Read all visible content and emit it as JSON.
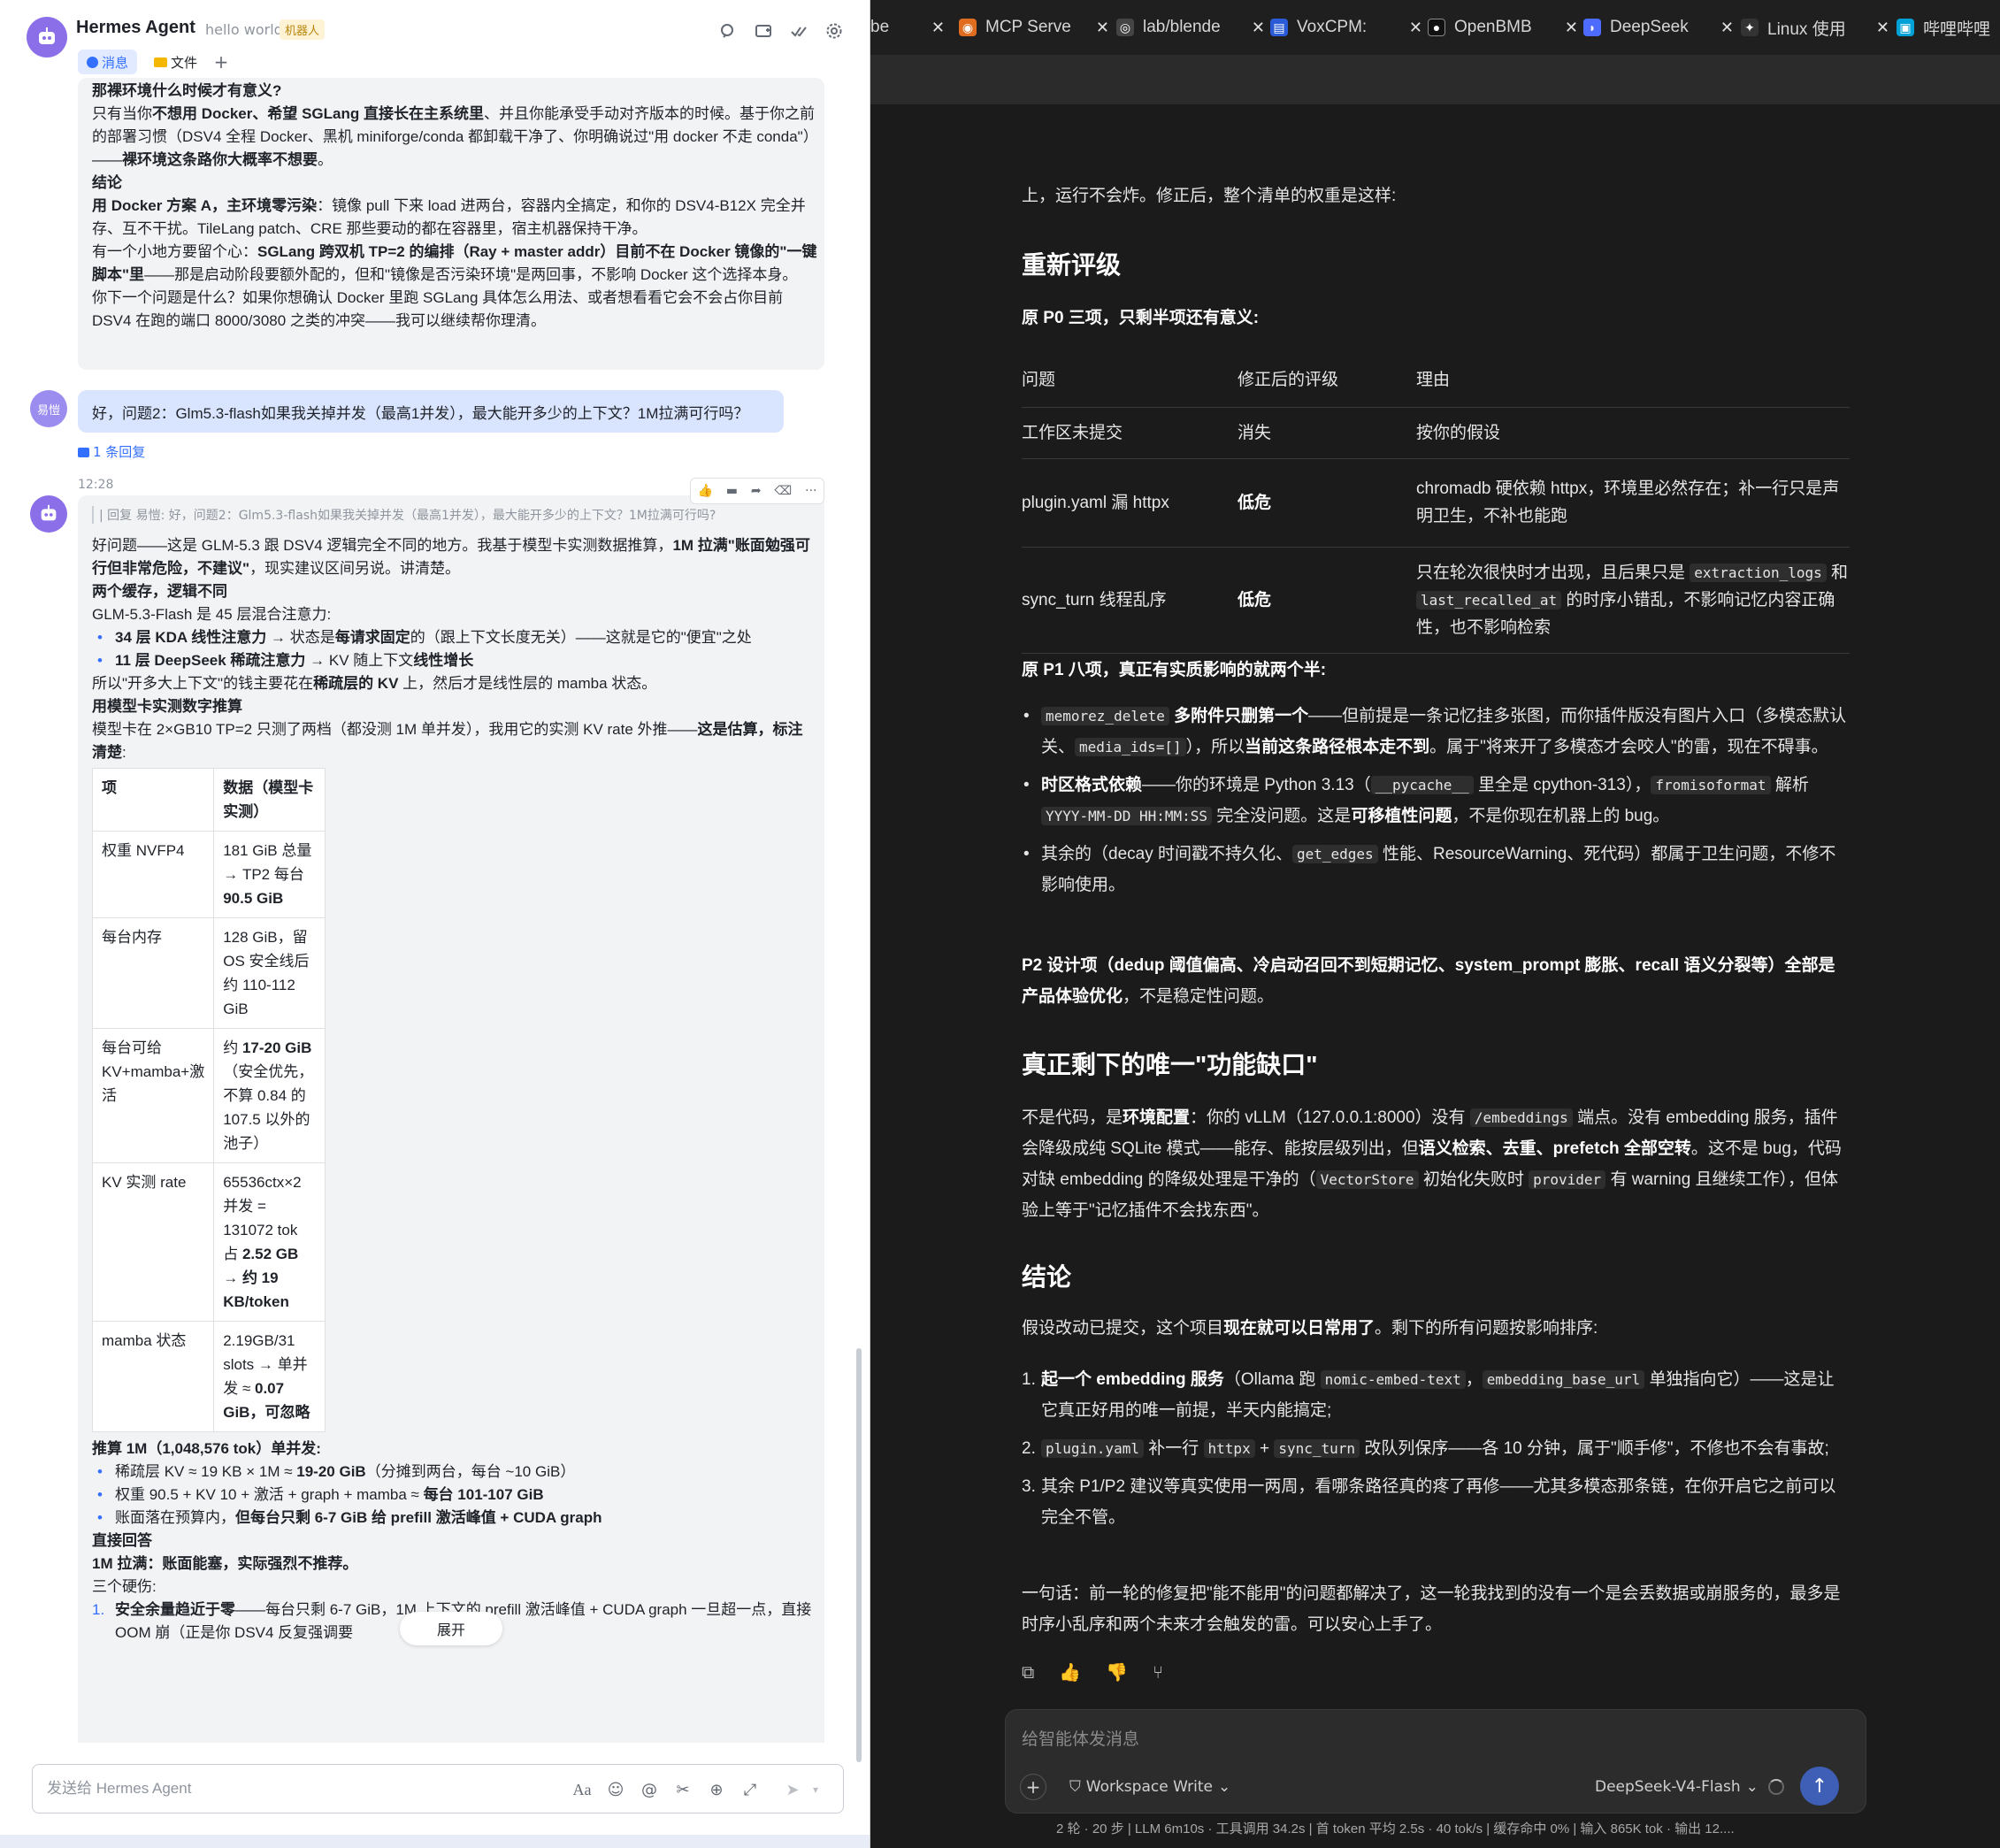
{
  "left": {
    "title": "Hermes Agent",
    "subtitle": "hello world",
    "badge": "机器人",
    "tabs": {
      "messages": "消息",
      "files": "文件",
      "add": "+"
    },
    "msg1": {
      "l1": "那裸环境什么时候才有意义?",
      "l2a": "只有当你",
      "l2b": "不想用 Docker、希望 SGLang 直接长在主系统里",
      "l2c": "、并且你能承受手动对齐版本的时候。基于你之前的部署习惯（DSV4 全程 Docker、黑机 miniforge/conda 都卸载干净了、你明确说过\"用 docker 不走 conda\"）——",
      "l2d": "裸环境这条路你大概率不想要",
      "l2e": "。",
      "l3": "结论",
      "l4a": "用 Docker 方案 A，主环境零污染",
      "l4b": "：镜像 pull 下来 load 进两台，容器内全搞定，和你的 DSV4-B12X 完全并存、互不干扰。TileLang patch、CRE 那些要动的都在容器里，宿主机器保持干净。",
      "l5a": "有一个小地方要留个心：",
      "l5b": "SGLang 跨双机 TP=2 的编排（Ray + master addr）目前不在 Docker 镜像的\"一键脚本\"里",
      "l5c": "——那是启动阶段要额外配的，但和\"镜像是否污染环境\"是两回事，不影响 Docker 这个选择本身。",
      "l6": "你下一个问题是什么？如果你想确认 Docker 里跑 SGLang 具体怎么用法、或者想看看它会不会占你目前 DSV4 在跑的端口 8000/3080 之类的冲突——我可以继续帮你理清。"
    },
    "user": {
      "avatar": "易愷",
      "text": "好，问题2：Glm5.3-flash如果我关掉并发（最高1并发），最大能开多少的上下文？1M拉满可行吗？",
      "reply_count": "1 条回复"
    },
    "timestamp": "12:28",
    "msg2": {
      "quote": "| 回复 易愷: 好，问题2：Glm5.3-flash如果我关掉并发（最高1并发），最大能开多少的上下文？1M拉满可行吗?",
      "p1a": "好问题——这是 GLM-5.3 跟 DSV4 逻辑完全不同的地方。我基于模型卡实测数据推算，",
      "p1b": "1M 拉满\"账面勉强可行但非常危险，不建议\"",
      "p1c": "，现实建议区间另说。讲清楚。",
      "h1": "两个缓存，逻辑不同",
      "p2": "GLM-5.3-Flash 是 45 层混合注意力:",
      "li1a": "34 层 KDA 线性注意力",
      "li1b": " → 状态是",
      "li1c": "每请求固定",
      "li1d": "的（跟上下文长度无关）——这就是它的\"便宜\"之处",
      "li2a": "11 层 DeepSeek 稀疏注意力",
      "li2b": " → KV 随上下文",
      "li2c": "线性增长",
      "p3a": "所以\"开多大上下文\"的钱主要花在",
      "p3b": "稀疏层的 KV",
      "p3c": " 上，然后才是线性层的 mamba 状态。",
      "h2": "用模型卡实测数字推算",
      "p4a": "模型卡在 2×GB10 TP=2 只测了两档（都没测 1M 单并发），我用它的实测 KV rate 外推——",
      "p4b": "这是估算，标注清楚",
      "p4c": ":",
      "table": {
        "h1": "项",
        "h2": "数据（模型卡实测）",
        "r1c1": "权重 NVFP4",
        "r1c2a": "181 GiB 总量 → TP2 每台 ",
        "r1c2b": "90.5 GiB",
        "r2c1": "每台内存",
        "r2c2": "128 GiB，留 OS 安全线后约 110-112 GiB",
        "r3c1": "每台可给 KV+mamba+激活",
        "r3c2a": "约 ",
        "r3c2b": "17-20 GiB",
        "r3c2c": "（安全优先，不算 0.84 的 107.5 以外的池子）",
        "r4c1": "KV 实测 rate",
        "r4c2a": "65536ctx×2 并发 = 131072 tok 占 ",
        "r4c2b": "2.52 GB → 约 19 KB/token",
        "r5c1": "mamba 状态",
        "r5c2a": "2.19GB/31 slots → 单并发 ≈ ",
        "r5c2b": "0.07 GiB，可忽略"
      },
      "h3": "推算 1M（1,048,576 tok）单并发:",
      "li3a": "稀疏层 KV ≈ 19 KB × 1M ≈ ",
      "li3b": "19-20 GiB",
      "li3c": "（分摊到两台，每台 ~10 GiB）",
      "li4a": "权重 90.5 + KV 10 + 激活 + graph + mamba ≈ ",
      "li4b": "每台 101-107 GiB",
      "li5a": "账面落在预算内，",
      "li5b": "但每台只剩 6-7 GiB 给 prefill 激活峰值 + CUDA graph",
      "h4": "直接回答",
      "h5": "1M 拉满：账面能塞，实际强烈不推荐。",
      "p5": "三个硬伤:",
      "oli1num": "1.",
      "oli1a": "安全余量趋近于零",
      "oli1b": "——每台只剩 6-7 GiB，1M 上下文的 prefill 激活峰值 + CUDA graph 一旦超一点，直接 OOM 崩（正是你 DSV4 反复强调要",
      "expand": "展开"
    },
    "composer_placeholder": "发送给 Hermes Agent"
  },
  "tabs": [
    {
      "label": "be"
    },
    {
      "label": "MCP Serve"
    },
    {
      "label": "lab/blende"
    },
    {
      "label": "VoxCPM:"
    },
    {
      "label": "OpenBMB"
    },
    {
      "label": "DeepSeek"
    },
    {
      "label": "Linux 使用"
    },
    {
      "label": "哔哩哔哩"
    }
  ],
  "article": {
    "p0": "上，运行不会炸。修正后，整个清单的权重是这样:",
    "h_regrade": "重新评级",
    "p_p0": "原 P0 三项，只剩半项还有意义:",
    "table": {
      "h1": "问题",
      "h2": "修正后的评级",
      "h3": "理由",
      "r1c1": "工作区未提交",
      "r1c2": "消失",
      "r1c3": "按你的假设",
      "r2c1": "plugin.yaml 漏 httpx",
      "r2c2": "低危",
      "r2c3": "chromadb 硬依赖 httpx，环境里必然存在；补一行只是声明卫生，不补也能跑",
      "r3c1": "sync_turn 线程乱序",
      "r3c2": "低危",
      "r3c3a": "只在轮次很快时才出现，且后果只是 ",
      "r3c3b": "extraction_logs",
      "r3c3c": " 和 ",
      "r3c3d": "last_recalled_at",
      "r3c3e": " 的时序小错乱，不影响记忆内容正确性，也不影响检索"
    },
    "p_p1": "原 P1 八项，真正有实质影响的就两个半:",
    "b1a": "memorez_delete",
    "b1b": " 多附件只删第一个",
    "b1c": "——但前提是一条记忆挂多张图，而你插件版没有图片入口（多模态默认关、",
    "b1d": "media_ids=[]",
    "b1e": "），所以",
    "b1f": "当前这条路径根本走不到",
    "b1g": "。属于\"将来开了多模态才会咬人\"的雷，现在不碍事。",
    "b2a": "时区格式依赖",
    "b2b": "——你的环境是 Python 3.13（",
    "b2c": "__pycache__",
    "b2d": " 里全是 cpython-313），",
    "b2e": "fromisoformat",
    "b2f": " 解析 ",
    "b2g": "YYYY-MM-DD HH:MM:SS",
    "b2h": " 完全没问题。这是",
    "b2i": "可移植性问题",
    "b2j": "，不是你现在机器上的 bug。",
    "b3a": "其余的（decay 时间戳不持久化、",
    "b3b": "get_edges",
    "b3c": " 性能、ResourceWarning、死代码）都属于卫生问题，不修不影响使用。",
    "p_p2a": "P2 设计项（dedup 阈值偏高、冷启动召回不到短期记忆、system_prompt 膨胀、recall 语义分裂等）全部是产品体验优化",
    "p_p2b": "，不是稳定性问题。",
    "h_gap": "真正剩下的唯一\"功能缺口\"",
    "g1": "不是代码，是",
    "g2": "环境配置",
    "g3": "：你的 vLLM（127.0.0.1:8000）没有 ",
    "g4": "/embeddings",
    "g5": " 端点。没有 embedding 服务，插件会降级成纯 SQLite 模式——能存、能按层级列出，但",
    "g6": "语义检索、去重、prefetch 全部空转",
    "g7": "。这不是 bug，代码对缺 embedding 的降级处理是干净的（",
    "g8": "VectorStore",
    "g9": " 初始化失败时 ",
    "g10": "provider",
    "g11": " 有 warning 且继续工作），但体验上等于\"记忆插件不会找东西\"。",
    "h_concl": "结论",
    "c1a": "假设改动已提交，这个项目",
    "c1b": "现在就可以日常用了",
    "c1c": "。剩下的所有问题按影响排序:",
    "o1num": "1.",
    "o1a": "起一个 embedding 服务",
    "o1b": "（Ollama 跑 ",
    "o1c": "nomic-embed-text",
    "o1d": "，",
    "o1e": "embedding_base_url",
    "o1f": " 单独指向它）——这是让它真正好用的唯一前提，半天内能搞定;",
    "o2num": "2.",
    "o2a": "plugin.yaml",
    "o2b": " 补一行 ",
    "o2c": "httpx",
    "o2d": " + ",
    "o2e": "sync_turn",
    "o2f": " 改队列保序——各 10 分钟，属于\"顺手修\"，不修也不会有事故;",
    "o3num": "3.",
    "o3a": "其余 P1/P2 建议等真实使用一两周，看哪条路径真的疼了再修——尤其多模态那条链，在你开启它之前可以完全不管。",
    "summary": "一句话：前一轮的修复把\"能不能用\"的问题都解决了，这一轮我找到的没有一个是会丢数据或崩服务的，最多是时序小乱序和两个未来才会触发的雷。可以安心上手了。"
  },
  "composer": {
    "placeholder": "给智能体发消息",
    "workspace": "Workspace Write",
    "model": "DeepSeek-V4-Flash"
  },
  "status": "2 轮 · 20 步  |  LLM 6m10s · 工具调用 34.2s  |  首 token 平均 2.5s · 40 tok/s  |  缓存命中 0%  |  输入 865K tok · 输出 12...."
}
